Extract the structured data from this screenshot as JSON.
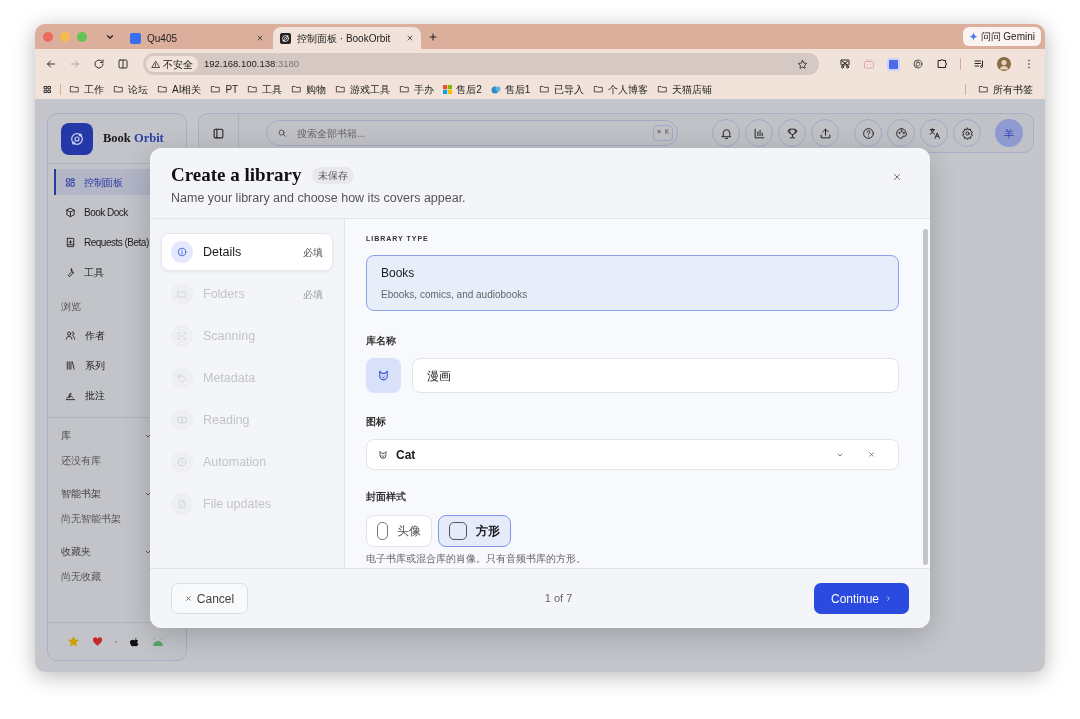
{
  "browser": {
    "tabs": [
      {
        "title": "Qu405",
        "selected": false
      },
      {
        "title": "控制面板 · BookOrbit",
        "selected": true
      }
    ],
    "gemini": "问问 Gemini",
    "address": {
      "security": "不安全",
      "host": "192.168.100.138",
      "port": ":3180"
    },
    "bookmarks": [
      {
        "kind": "folder",
        "label": "工作"
      },
      {
        "kind": "folder",
        "label": "论坛"
      },
      {
        "kind": "folder",
        "label": "AI相关"
      },
      {
        "kind": "folder",
        "label": "PT"
      },
      {
        "kind": "folder",
        "label": "工具"
      },
      {
        "kind": "folder",
        "label": "购物"
      },
      {
        "kind": "folder",
        "label": "游戏工具"
      },
      {
        "kind": "folder",
        "label": "手办"
      },
      {
        "kind": "tiles",
        "label": "售后2"
      },
      {
        "kind": "site",
        "label": "售后1"
      },
      {
        "kind": "folder",
        "label": "已导入"
      },
      {
        "kind": "folder",
        "label": "个人博客"
      },
      {
        "kind": "folder",
        "label": "天猫店铺"
      }
    ],
    "all_bookmarks": "所有书签"
  },
  "app": {
    "brand": {
      "first": "Book",
      "second": "Orbit"
    },
    "nav": [
      {
        "label": "控制面板",
        "selected": true
      },
      {
        "label": "Book Dock",
        "selected": false
      },
      {
        "label": "Requests (Beta)",
        "selected": false
      },
      {
        "label": "工具",
        "selected": false
      }
    ],
    "browse_title": "浏览",
    "browse": [
      {
        "label": "作者"
      },
      {
        "label": "系列"
      },
      {
        "label": "批注"
      }
    ],
    "groups": [
      {
        "title": "库",
        "empty": "还没有库"
      },
      {
        "title": "智能书架",
        "empty": "尚无智能书架"
      },
      {
        "title": "收藏夹",
        "empty": "尚无收藏"
      }
    ],
    "search_placeholder": "搜索全部书籍...",
    "shortcut": "⌘ K",
    "avatar": "羊"
  },
  "modal": {
    "title": "Create a library",
    "badge": "未保存",
    "subtitle": "Name your library and choose how its covers appear.",
    "steps": [
      {
        "label": "Details",
        "badge": "必填",
        "selected": true,
        "disabled": false
      },
      {
        "label": "Folders",
        "badge": "必填",
        "selected": false,
        "disabled": true
      },
      {
        "label": "Scanning",
        "selected": false,
        "disabled": true
      },
      {
        "label": "Metadata",
        "selected": false,
        "disabled": true
      },
      {
        "label": "Reading",
        "selected": false,
        "disabled": true
      },
      {
        "label": "Automation",
        "selected": false,
        "disabled": true
      },
      {
        "label": "File updates",
        "selected": false,
        "disabled": true
      }
    ],
    "library_type": {
      "label": "LIBRARY TYPE",
      "options": [
        {
          "title": "Books",
          "description": "Ebooks, comics, and audiobooks",
          "selected": true
        }
      ]
    },
    "name": {
      "label": "库名称",
      "value": "漫画"
    },
    "icon": {
      "label": "图标",
      "value": "Cat"
    },
    "cover": {
      "label": "封面样式",
      "options": [
        {
          "label": "头像",
          "kind": "portrait",
          "selected": false
        },
        {
          "label": "方形",
          "kind": "square",
          "selected": true
        }
      ],
      "hint": "电子书库或混合库的肖像。只有音频书库的方形。"
    },
    "cancel": "Cancel",
    "page": "1 of 7",
    "continue": "Continue"
  }
}
